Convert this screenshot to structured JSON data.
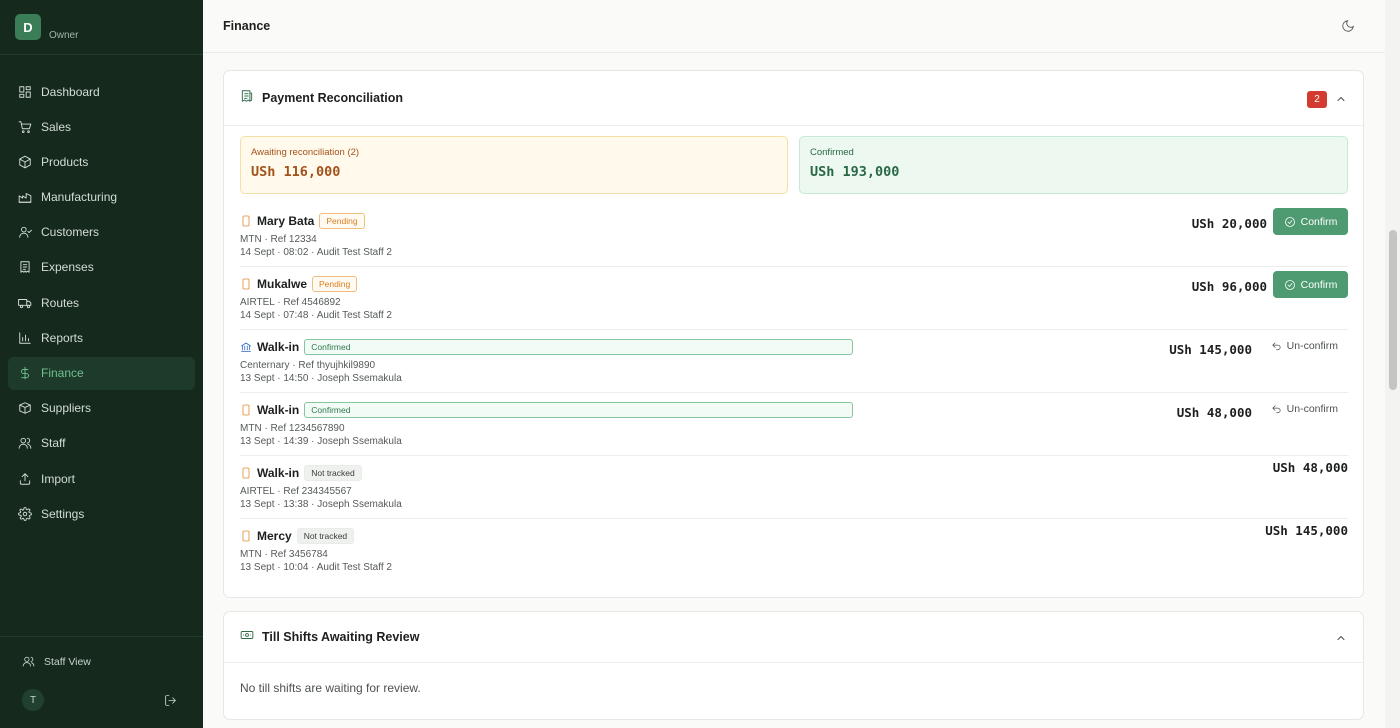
{
  "app": {
    "avatar_initial": "D",
    "role": "Owner"
  },
  "sidebar": {
    "items": [
      {
        "label": "Dashboard",
        "icon": "dashboard-icon"
      },
      {
        "label": "Sales",
        "icon": "cart-icon"
      },
      {
        "label": "Products",
        "icon": "package-icon"
      },
      {
        "label": "Manufacturing",
        "icon": "factory-icon"
      },
      {
        "label": "Customers",
        "icon": "user-icon"
      },
      {
        "label": "Expenses",
        "icon": "receipt-icon"
      },
      {
        "label": "Routes",
        "icon": "truck-icon"
      },
      {
        "label": "Reports",
        "icon": "bar-chart-icon"
      },
      {
        "label": "Finance",
        "icon": "dollar-icon",
        "active": true
      },
      {
        "label": "Suppliers",
        "icon": "box-icon"
      },
      {
        "label": "Staff",
        "icon": "users-icon"
      },
      {
        "label": "Import",
        "icon": "upload-icon"
      },
      {
        "label": "Settings",
        "icon": "gear-icon"
      }
    ],
    "staff_view_label": "Staff View",
    "user_initial": "T"
  },
  "header": {
    "title": "Finance"
  },
  "reconciliation": {
    "title": "Payment Reconciliation",
    "badge_count": "2",
    "awaiting_label": "Awaiting reconciliation (2)",
    "awaiting_amount": "USh 116,000",
    "confirmed_label": "Confirmed",
    "confirmed_amount": "USh 193,000",
    "payments": [
      {
        "method_icon": "phone-icon",
        "payer": "Mary Bata",
        "status": "Pending",
        "status_type": "pending",
        "meta1": "MTN · Ref 12334",
        "meta2": "14 Sept · 08:02 · Audit Test Staff 2",
        "amount": "USh 20,000",
        "action": "Confirm"
      },
      {
        "method_icon": "phone-icon",
        "payer": "Mukalwe",
        "status": "Pending",
        "status_type": "pending",
        "meta1": "AIRTEL · Ref 4546892",
        "meta2": "14 Sept · 07:48 · Audit Test Staff 2",
        "amount": "USh 96,000",
        "action": "Confirm"
      },
      {
        "method_icon": "bank-icon",
        "payer": "Walk-in",
        "status": "Confirmed",
        "status_type": "confirmed",
        "meta1": "Centernary · Ref thyujhkil9890",
        "meta2": "13 Sept · 14:50 · Joseph Ssemakula",
        "amount": "USh 145,000",
        "action": "Un-confirm"
      },
      {
        "method_icon": "phone-icon",
        "payer": "Walk-in",
        "status": "Confirmed",
        "status_type": "confirmed",
        "meta1": "MTN · Ref 1234567890",
        "meta2": "13 Sept · 14:39 · Joseph Ssemakula",
        "amount": "USh 48,000",
        "action": "Un-confirm"
      },
      {
        "method_icon": "phone-icon",
        "payer": "Walk-in",
        "status": "Not tracked",
        "status_type": "nottracked",
        "meta1": "AIRTEL · Ref 234345567",
        "meta2": "13 Sept · 13:38 · Joseph Ssemakula",
        "amount": "USh 48,000",
        "action": ""
      },
      {
        "method_icon": "phone-icon",
        "payer": "Mercy",
        "status": "Not tracked",
        "status_type": "nottracked",
        "meta1": "MTN · Ref 3456784",
        "meta2": "13 Sept · 10:04 · Audit Test Staff 2",
        "amount": "USh 145,000",
        "action": ""
      }
    ]
  },
  "till": {
    "title": "Till Shifts Awaiting Review",
    "empty_text": "No till shifts are waiting for review."
  },
  "colors": {
    "sidebar_bg": "#15291d",
    "accent": "#4e9a71",
    "badge": "#d33b31"
  }
}
